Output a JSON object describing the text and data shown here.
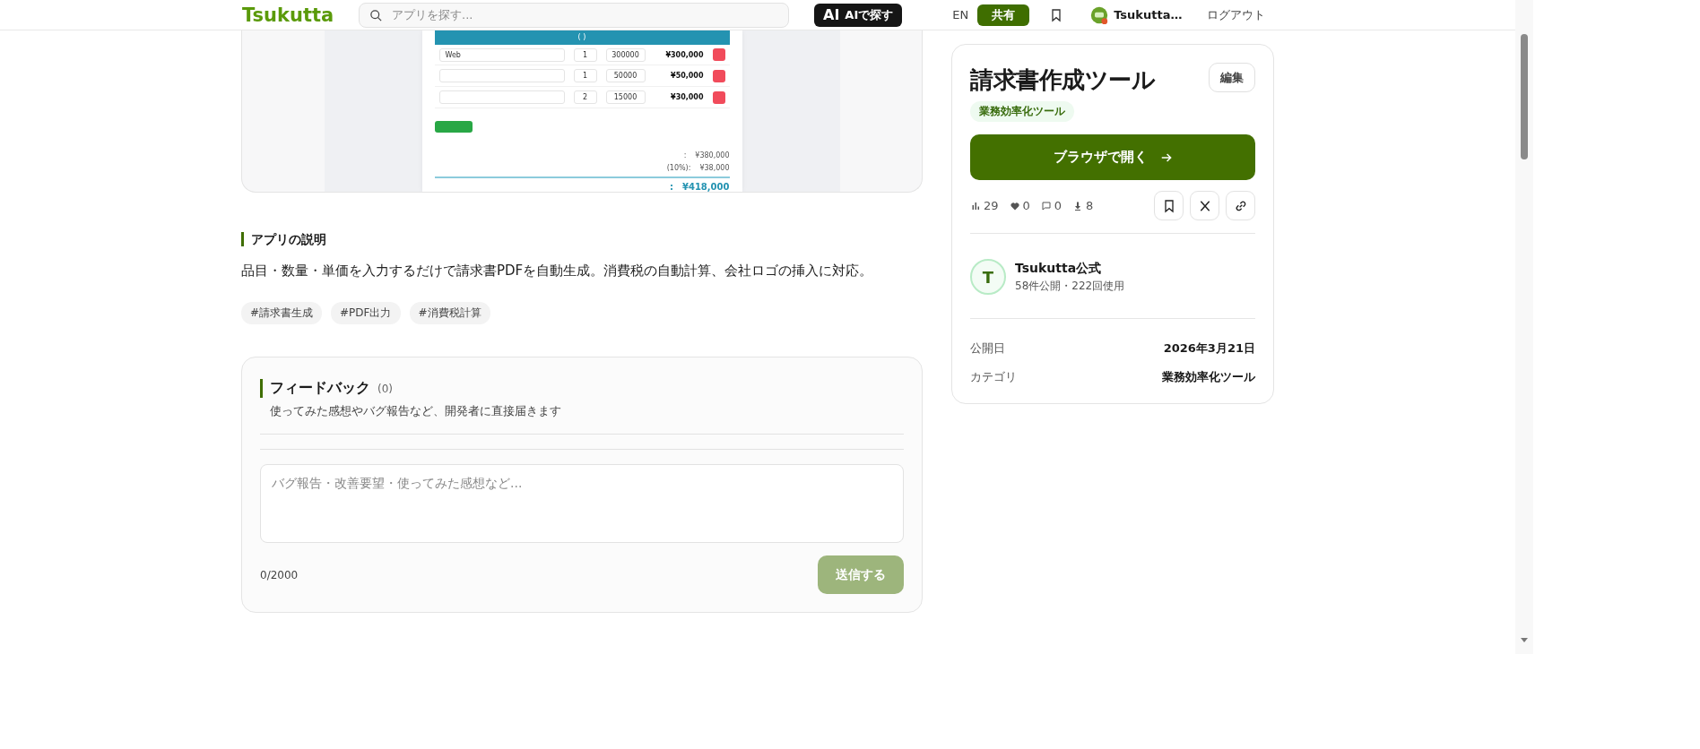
{
  "header": {
    "logo": "Tsukutta",
    "search": {
      "placeholder": "アプリを探す..."
    },
    "ai_button": {
      "badge": "AI",
      "label": "AIで探す"
    },
    "language": "EN",
    "share_button": "共有",
    "user_name": "Tsukutta…",
    "logout": "ログアウト"
  },
  "preview": {
    "table_header": "( )",
    "rows": [
      {
        "item": "Web",
        "qty": "1",
        "price": "300000",
        "amount": "¥300,000"
      },
      {
        "qty": "1",
        "price": "50000",
        "amount": "¥50,000"
      },
      {
        "qty": "2",
        "price": "15000",
        "amount": "¥30,000"
      }
    ],
    "subtotal": {
      "label": ":",
      "value": "¥380,000"
    },
    "tax": {
      "label": "(10%):",
      "value": "¥38,000"
    },
    "total": {
      "label": ":",
      "value": "¥418,000"
    }
  },
  "description": {
    "heading": "アプリの説明",
    "text": "品目・数量・単価を入力するだけで請求書PDFを自動生成。消費税の自動計算、会社ロゴの挿入に対応。",
    "tags": [
      "#請求書生成",
      "#PDF出力",
      "#消費税計算"
    ]
  },
  "feedback": {
    "heading": "フィードバック",
    "count": "(0)",
    "subtitle": "使ってみた感想やバグ報告など、開発者に直接届きます",
    "input": {
      "placeholder": "バグ報告・改善要望・使ってみた感想など..."
    },
    "counter": "0/2000",
    "submit": {
      "label": "送信する",
      "disabled": true
    }
  },
  "app_card": {
    "title": "請求書作成ツール",
    "edit_button": "編集",
    "category_badge": "業務効率化ツール",
    "open_button": "ブラウザで開く",
    "stats": [
      {
        "kind": "views",
        "value": "29"
      },
      {
        "kind": "likes",
        "value": "0"
      },
      {
        "kind": "comments",
        "value": "0"
      },
      {
        "kind": "downloads",
        "value": "8"
      }
    ],
    "author": {
      "initial": "T",
      "name": "Tsukutta公式",
      "meta": "58件公開・222回使用"
    },
    "details": [
      {
        "label": "公開日",
        "value": "2026年3月21日"
      },
      {
        "label": "カテゴリ",
        "value": "業務効率化ツール"
      }
    ]
  }
}
